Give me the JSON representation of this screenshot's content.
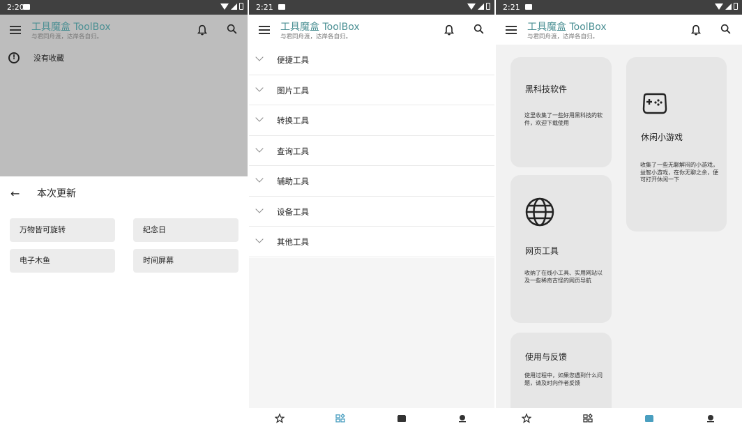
{
  "app": {
    "title": "工具魔盒 ToolBox",
    "subtitle": "与君同舟渡，达岸各自归。",
    "accent_color": "#4a8f93"
  },
  "statusbars": [
    {
      "time": "2:20"
    },
    {
      "time": "2:21"
    },
    {
      "time": "2:21"
    }
  ],
  "favorites": {
    "empty_text": "没有收藏"
  },
  "update_sheet": {
    "title": "本次更新",
    "chips": [
      "万物皆可旋转",
      "纪念日",
      "电子木鱼",
      "时间屏幕"
    ]
  },
  "categories": [
    "便捷工具",
    "图片工具",
    "转换工具",
    "查询工具",
    "辅助工具",
    "设备工具",
    "其他工具"
  ],
  "cards": {
    "blacktech": {
      "title": "黑科技软件",
      "desc": "这里收集了一些好用黑科技的软件，欢迎下载使用"
    },
    "games": {
      "title": "休闲小游戏",
      "desc": "收集了一些无聊解闷的小游戏，益智小游戏，在你无聊之余，便可打开休闲一下",
      "icon": "gamepad-icon"
    },
    "web": {
      "title": "网页工具",
      "desc": "收纳了在线小工具、实用网站以及一些稀奇古怪的网页导航",
      "icon": "globe-icon"
    },
    "feedback": {
      "title": "使用与反馈",
      "desc": "使用过程中，如果您遇到什么问题，请及时向作者反馈"
    }
  },
  "bottom_nav": [
    {
      "icon": "star-icon",
      "active": false
    },
    {
      "icon": "tools-grid-icon",
      "active": true
    },
    {
      "icon": "box-icon",
      "active": false
    },
    {
      "icon": "person-icon",
      "active": false
    }
  ]
}
